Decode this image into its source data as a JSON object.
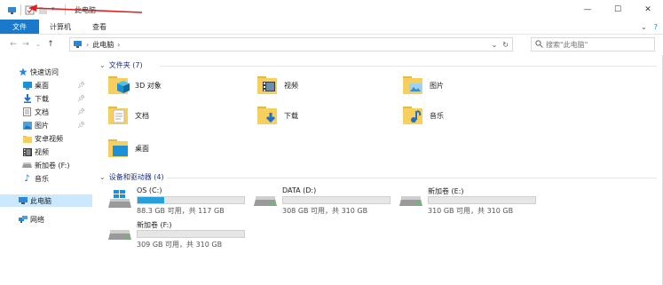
{
  "window": {
    "title": "此电脑",
    "controls": {
      "minimize": "—",
      "maximize": "☐",
      "close": "✕"
    }
  },
  "ribbon": {
    "tabs": [
      {
        "label": "文件"
      },
      {
        "label": "计算机"
      },
      {
        "label": "查看"
      }
    ],
    "expand_icon": "⌄",
    "help_icon": "?"
  },
  "address": {
    "breadcrumb": "此电脑",
    "search_placeholder": "搜索\"此电脑\""
  },
  "sidebar": {
    "items": [
      {
        "label": "快速访问",
        "icon": "star-icon"
      },
      {
        "label": "桌面",
        "icon": "desktop-icon",
        "pinned": true
      },
      {
        "label": "下载",
        "icon": "download-icon",
        "pinned": true
      },
      {
        "label": "文档",
        "icon": "document-icon",
        "pinned": true
      },
      {
        "label": "图片",
        "icon": "picture-icon",
        "pinned": true
      },
      {
        "label": "安卓视频",
        "icon": "folder-icon"
      },
      {
        "label": "视频",
        "icon": "video-icon"
      },
      {
        "label": "新加卷 (F:)",
        "icon": "drive-icon"
      },
      {
        "label": "音乐",
        "icon": "music-icon"
      },
      {
        "label": "此电脑",
        "icon": "pc-icon"
      },
      {
        "label": "网络",
        "icon": "network-icon"
      }
    ]
  },
  "folders_section": {
    "title": "文件夹 (7)",
    "items": [
      {
        "label": "3D 对象",
        "icon": "3d-objects-icon"
      },
      {
        "label": "视频",
        "icon": "video-folder-icon"
      },
      {
        "label": "图片",
        "icon": "pictures-folder-icon"
      },
      {
        "label": "文档",
        "icon": "documents-folder-icon"
      },
      {
        "label": "下载",
        "icon": "downloads-folder-icon"
      },
      {
        "label": "音乐",
        "icon": "music-folder-icon"
      },
      {
        "label": "桌面",
        "icon": "desktop-folder-icon"
      }
    ]
  },
  "drives_section": {
    "title": "设备和驱动器 (4)",
    "items": [
      {
        "name": "OS (C:)",
        "free": "88.3 GB 可用，共 117 GB",
        "used_fraction": 0.25,
        "icon": "windows-drive-icon"
      },
      {
        "name": "DATA (D:)",
        "free": "308 GB 可用，共 310 GB",
        "used_fraction": 0.0,
        "icon": "hard-drive-icon"
      },
      {
        "name": "新加卷 (E:)",
        "free": "310 GB 可用，共 310 GB",
        "used_fraction": 0.0,
        "icon": "hard-drive-icon"
      },
      {
        "name": "新加卷 (F:)",
        "free": "309 GB 可用，共 310 GB",
        "used_fraction": 0.0,
        "icon": "hard-drive-icon"
      }
    ]
  },
  "colors": {
    "accent": "#1979ca",
    "selected": "#cce8ff",
    "bar_fill": "#26a0da",
    "annotation": "#e02020"
  }
}
